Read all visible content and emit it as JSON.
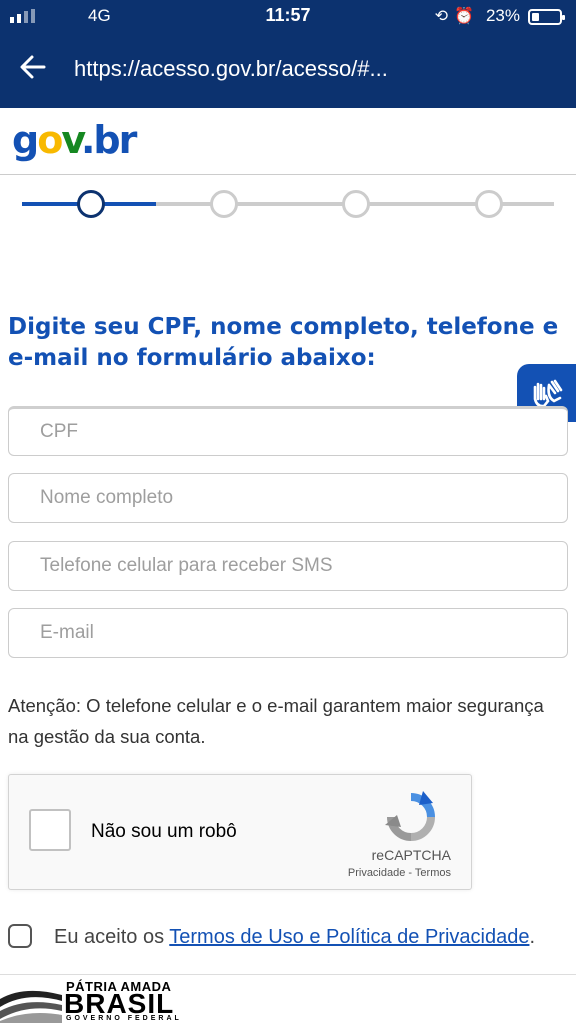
{
  "status_bar": {
    "network": "4G",
    "time": "11:57",
    "battery": "23%",
    "icons": [
      "rotation-lock-icon",
      "alarm-icon"
    ]
  },
  "browser": {
    "url": "https://acesso.gov.br/acesso/#..."
  },
  "logo": {
    "g": "g",
    "o": "o",
    "v": "v",
    "dot": ".",
    "br": "br"
  },
  "stepper": {
    "total_steps": 4,
    "current_step": 1
  },
  "form": {
    "heading": "Digite seu CPF, nome completo, telefone e e-mail no formulário abaixo:",
    "fields": {
      "cpf": {
        "placeholder": "CPF"
      },
      "name": {
        "placeholder": "Nome completo"
      },
      "phone": {
        "placeholder": "Telefone celular para receber SMS"
      },
      "email": {
        "placeholder": "E-mail"
      }
    },
    "attention_label": "Atenção",
    "attention_text": ": O telefone celular e o e-mail garantem maior segurança na gestão da sua conta."
  },
  "captcha": {
    "label": "Não sou um robô",
    "brand": "reCAPTCHA",
    "links": "Privacidade - Termos"
  },
  "terms": {
    "prefix": "Eu aceito os ",
    "link": "Termos de Uso e Política de Privacidade",
    "suffix": "."
  },
  "footer": {
    "line1": "PÁTRIA AMADA",
    "line2": "BRASIL",
    "line3": "GOVERNO FEDERAL"
  },
  "colors": {
    "header_bg": "#0c326f",
    "primary": "#1351b4",
    "logo_yellow": "#f8b900",
    "logo_green": "#168821"
  }
}
